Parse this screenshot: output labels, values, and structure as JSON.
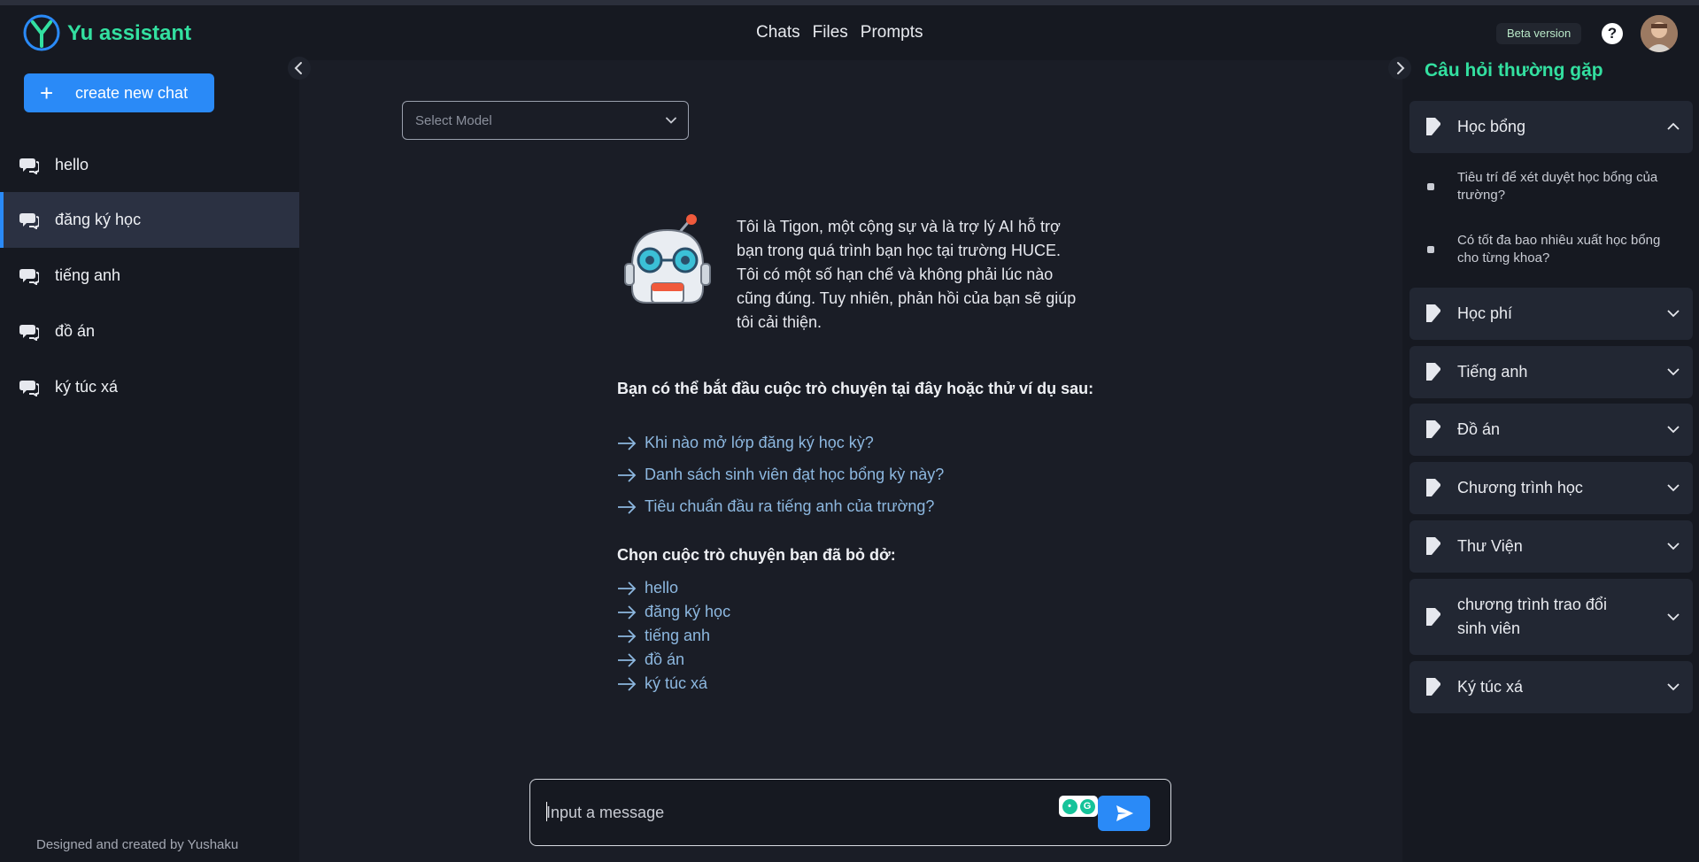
{
  "app": {
    "brand": "Yu assistant",
    "accent": "#33e0a0",
    "primary": "#2a8af7",
    "beta_badge": "Beta version",
    "help_symbol": "?"
  },
  "topnav": [
    "Chats",
    "Files",
    "Prompts"
  ],
  "sidebar": {
    "new_chat_label": "create new chat",
    "chats": [
      "hello",
      "đăng ký học",
      "tiếng anh",
      "đồ án",
      "ký túc xá"
    ],
    "active_chat": "đăng ký học",
    "footer": "Designed and created by Yushaku"
  },
  "main": {
    "model_select_placeholder": "Select Model",
    "intro": "Tôi là Tigon, một cộng sự và là trợ lý AI hỗ trợ bạn trong quá trình bạn học tại trường HUCE. Tôi có một số hạn chế và không phải lúc nào cũng đúng. Tuy nhiên, phản hồi của bạn sẽ giúp tôi cải thiện.",
    "suggest_heading": "Bạn có thể bắt đầu cuộc trò chuyện tại đây hoặc thử ví dụ sau:",
    "suggestions": [
      "Khi nào mở lớp đăng ký học kỳ?",
      "Danh sách sinh viên đạt học bổng kỳ này?",
      "Tiêu chuẩn đầu ra tiếng anh của trường?"
    ],
    "recent_heading": "Chọn cuộc trò chuyện bạn đã bỏ dở:",
    "recent": [
      "hello",
      "đăng ký học",
      "tiếng anh",
      "đồ án",
      "ký túc xá"
    ],
    "input_placeholder": "Input a message"
  },
  "faq": {
    "title": "Câu hỏi thường gặp",
    "items": [
      {
        "label": "Học bổng",
        "expanded": true
      },
      {
        "label": "Học phí",
        "expanded": false
      },
      {
        "label": "Tiếng anh",
        "expanded": false
      },
      {
        "label": "Đồ án",
        "expanded": false
      },
      {
        "label": "Chương trình học",
        "expanded": false
      },
      {
        "label": "Thư Viện",
        "expanded": false
      },
      {
        "label": "chương trình trao đổi sinh viên",
        "expanded": false
      },
      {
        "label": "Ký túc xá",
        "expanded": false
      }
    ],
    "expanded_questions": [
      "Tiêu trí để xét duyệt học bổng của trường?",
      "Có tốt đa bao nhiêu xuất học bổng cho từng khoa?"
    ]
  }
}
